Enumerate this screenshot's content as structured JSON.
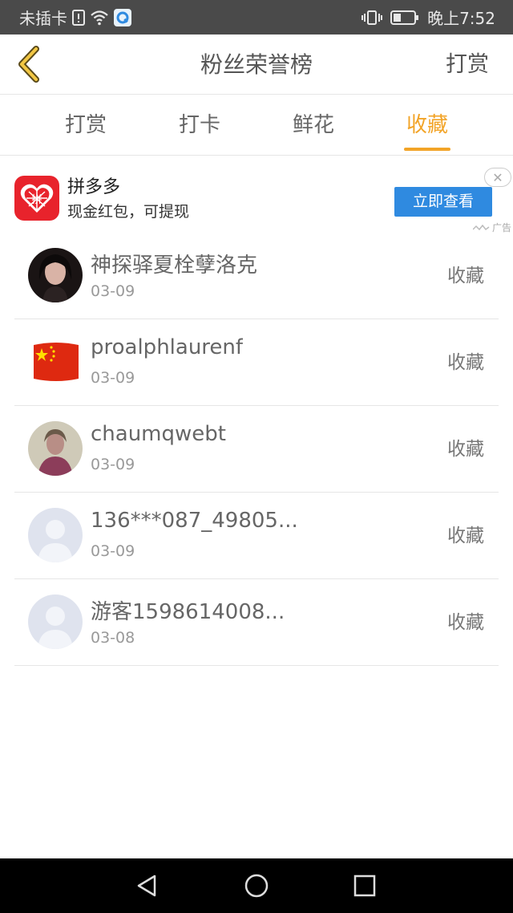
{
  "status_bar": {
    "carrier": "未插卡",
    "time": "晚上7:52"
  },
  "header": {
    "title": "粉丝荣誉榜",
    "action": "打赏"
  },
  "tabs": [
    {
      "label": "打赏",
      "active": false
    },
    {
      "label": "打卡",
      "active": false
    },
    {
      "label": "鲜花",
      "active": false
    },
    {
      "label": "收藏",
      "active": true
    }
  ],
  "ad": {
    "title": "拼多多",
    "subtitle": "现金红包，可提现",
    "button": "立即查看",
    "mark": "广告",
    "logo_text": "拼"
  },
  "list": [
    {
      "name": "神探驿夏栓孽洛克",
      "date": "03-09",
      "action": "收藏",
      "avatar": "photo-woman"
    },
    {
      "name": "proalphlaurenf",
      "date": "03-09",
      "action": "收藏",
      "avatar": "china-flag"
    },
    {
      "name": "chaumqwebt",
      "date": "03-09",
      "action": "收藏",
      "avatar": "photo-person"
    },
    {
      "name": "136***087_49805...",
      "date": "03-09",
      "action": "收藏",
      "avatar": "default"
    },
    {
      "name": "游客1598614008...",
      "date": "03-08",
      "action": "收藏",
      "avatar": "default"
    }
  ],
  "colors": {
    "accent": "#f2a428",
    "ad_button": "#2f8ae0",
    "ad_logo": "#e8232c",
    "status_bar": "#4a4a4a"
  }
}
